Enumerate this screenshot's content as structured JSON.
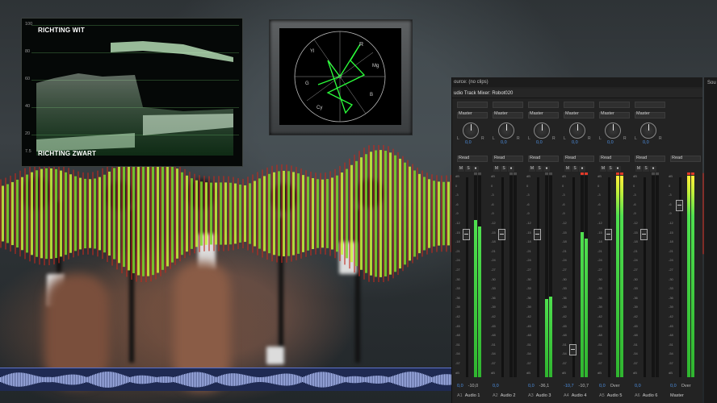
{
  "waveform_monitor": {
    "label_top": "RICHTING WIT",
    "label_bottom": "RICHTING ZWART",
    "scale": [
      "100",
      "80",
      "60",
      "40",
      "20",
      "7.5"
    ]
  },
  "vectorscope": {
    "targets": [
      "R",
      "Mg",
      "B",
      "Cy",
      "G",
      "Yl"
    ]
  },
  "panel": {
    "source_tab": "ource: (no clips)",
    "mixer_tab": "udio Track Mixer: Robot020",
    "right_tab": "Sou"
  },
  "mixer": {
    "tracks": [
      {
        "id": "A1",
        "name": "Audio 1",
        "output": "Master",
        "pan": "0,0",
        "automation": "Read",
        "volume": "0,0",
        "peak": "-10,0",
        "m": "M",
        "s": "S",
        "level": 0.78,
        "level2": 0.75,
        "clip": false
      },
      {
        "id": "A2",
        "name": "Audio 2",
        "output": "Master",
        "pan": "0,0",
        "automation": "Read",
        "volume": "0,0",
        "peak": "",
        "m": "M",
        "s": "S",
        "level": 0.0,
        "level2": 0.0,
        "clip": false
      },
      {
        "id": "A3",
        "name": "Audio 3",
        "output": "Master",
        "pan": "0,0",
        "automation": "Read",
        "volume": "0,0",
        "peak": "-36,1",
        "m": "M",
        "s": "S",
        "level": 0.39,
        "level2": 0.4,
        "clip": false
      },
      {
        "id": "A4",
        "name": "Audio 4",
        "output": "Master",
        "pan": "0,0",
        "automation": "Read",
        "volume": "-10,7",
        "peak": "-10,7",
        "m": "M",
        "s": "S",
        "level": 0.72,
        "level2": 0.69,
        "clip": true
      },
      {
        "id": "A5",
        "name": "Audio 5",
        "output": "Master",
        "pan": "0,0",
        "automation": "Read",
        "volume": "0,0",
        "peak": "Over",
        "m": "M",
        "s": "S",
        "level": 1.0,
        "level2": 1.0,
        "clip": true
      },
      {
        "id": "A6",
        "name": "Audio 6",
        "output": "Master",
        "pan": "0,0",
        "automation": "Read",
        "volume": "0,0",
        "peak": "",
        "m": "M",
        "s": "S",
        "level": 0.0,
        "level2": 0.0,
        "clip": false
      }
    ],
    "master": {
      "name": "Master",
      "automation": "Read",
      "volume": "0,0",
      "peak": "Over",
      "level": 1.0,
      "level2": 1.0,
      "clip": true
    }
  },
  "colors": {
    "meter_green": "#2fb52f",
    "clip_red": "#e23a2a",
    "value_blue": "#4d8fe0",
    "scope_green": "#2bff3a"
  }
}
